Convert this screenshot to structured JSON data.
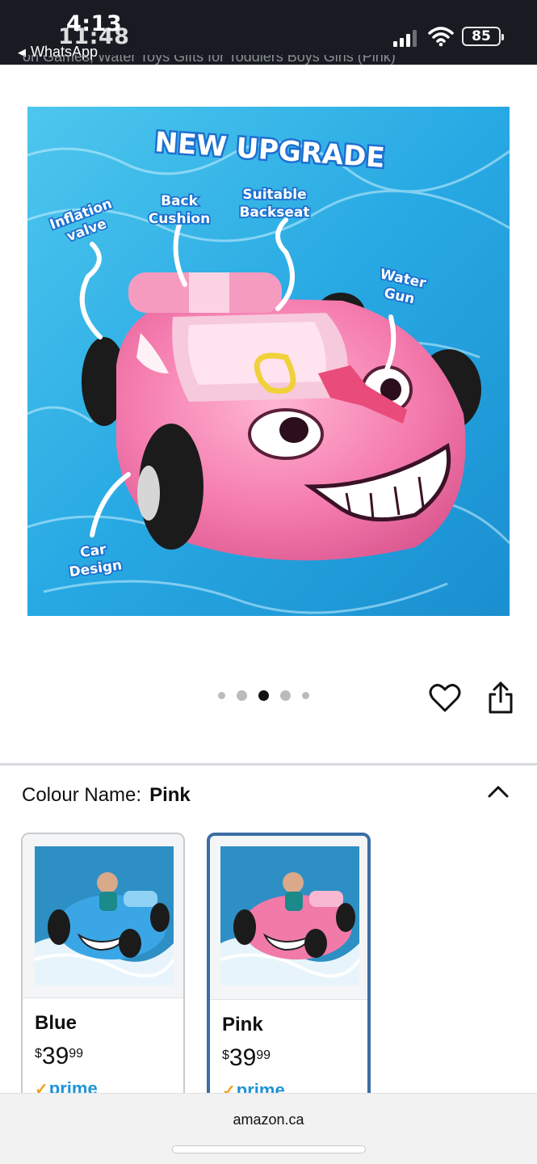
{
  "status_bar": {
    "time_primary": "4:13",
    "time_overlay": "11:48",
    "back_app": "WhatsApp",
    "battery": "85"
  },
  "product": {
    "title_cut": "on Games, Water Toys Gifts for Toddlers Boys Girls (Pink)",
    "hero_labels": {
      "headline": "NEW UPGRADE",
      "inflation_valve": [
        "Inflation",
        "valve"
      ],
      "back_cushion": [
        "Back",
        "Cushion"
      ],
      "suitable_backseat": [
        "Suitable",
        "Backseat"
      ],
      "water_gun": [
        "Water",
        "Gun"
      ],
      "car_design": [
        "Car",
        "Design"
      ]
    },
    "carousel": {
      "count": 5,
      "active_index": 2
    }
  },
  "variation": {
    "label": "Colour Name:",
    "value": "Pink",
    "options": [
      {
        "name": "Blue",
        "currency": "$",
        "price_whole": "39",
        "price_fraction": "99",
        "prime": "prime",
        "color": "#3aa6e6",
        "selected": false
      },
      {
        "name": "Pink",
        "currency": "$",
        "price_whole": "39",
        "price_fraction": "99",
        "prime": "prime",
        "color": "#f17aa9",
        "selected": true
      }
    ]
  },
  "browser": {
    "url": "amazon.ca"
  },
  "colors": {
    "status_bar_bg": "#181c22",
    "selected_border": "#3a6ea5",
    "prime_blue": "#1f93d5",
    "prime_check": "#f0a020"
  },
  "icons": [
    "signal-icon",
    "wifi-icon",
    "battery-icon",
    "heart-icon",
    "share-icon",
    "chevron-up-icon",
    "back-triangle-icon"
  ]
}
